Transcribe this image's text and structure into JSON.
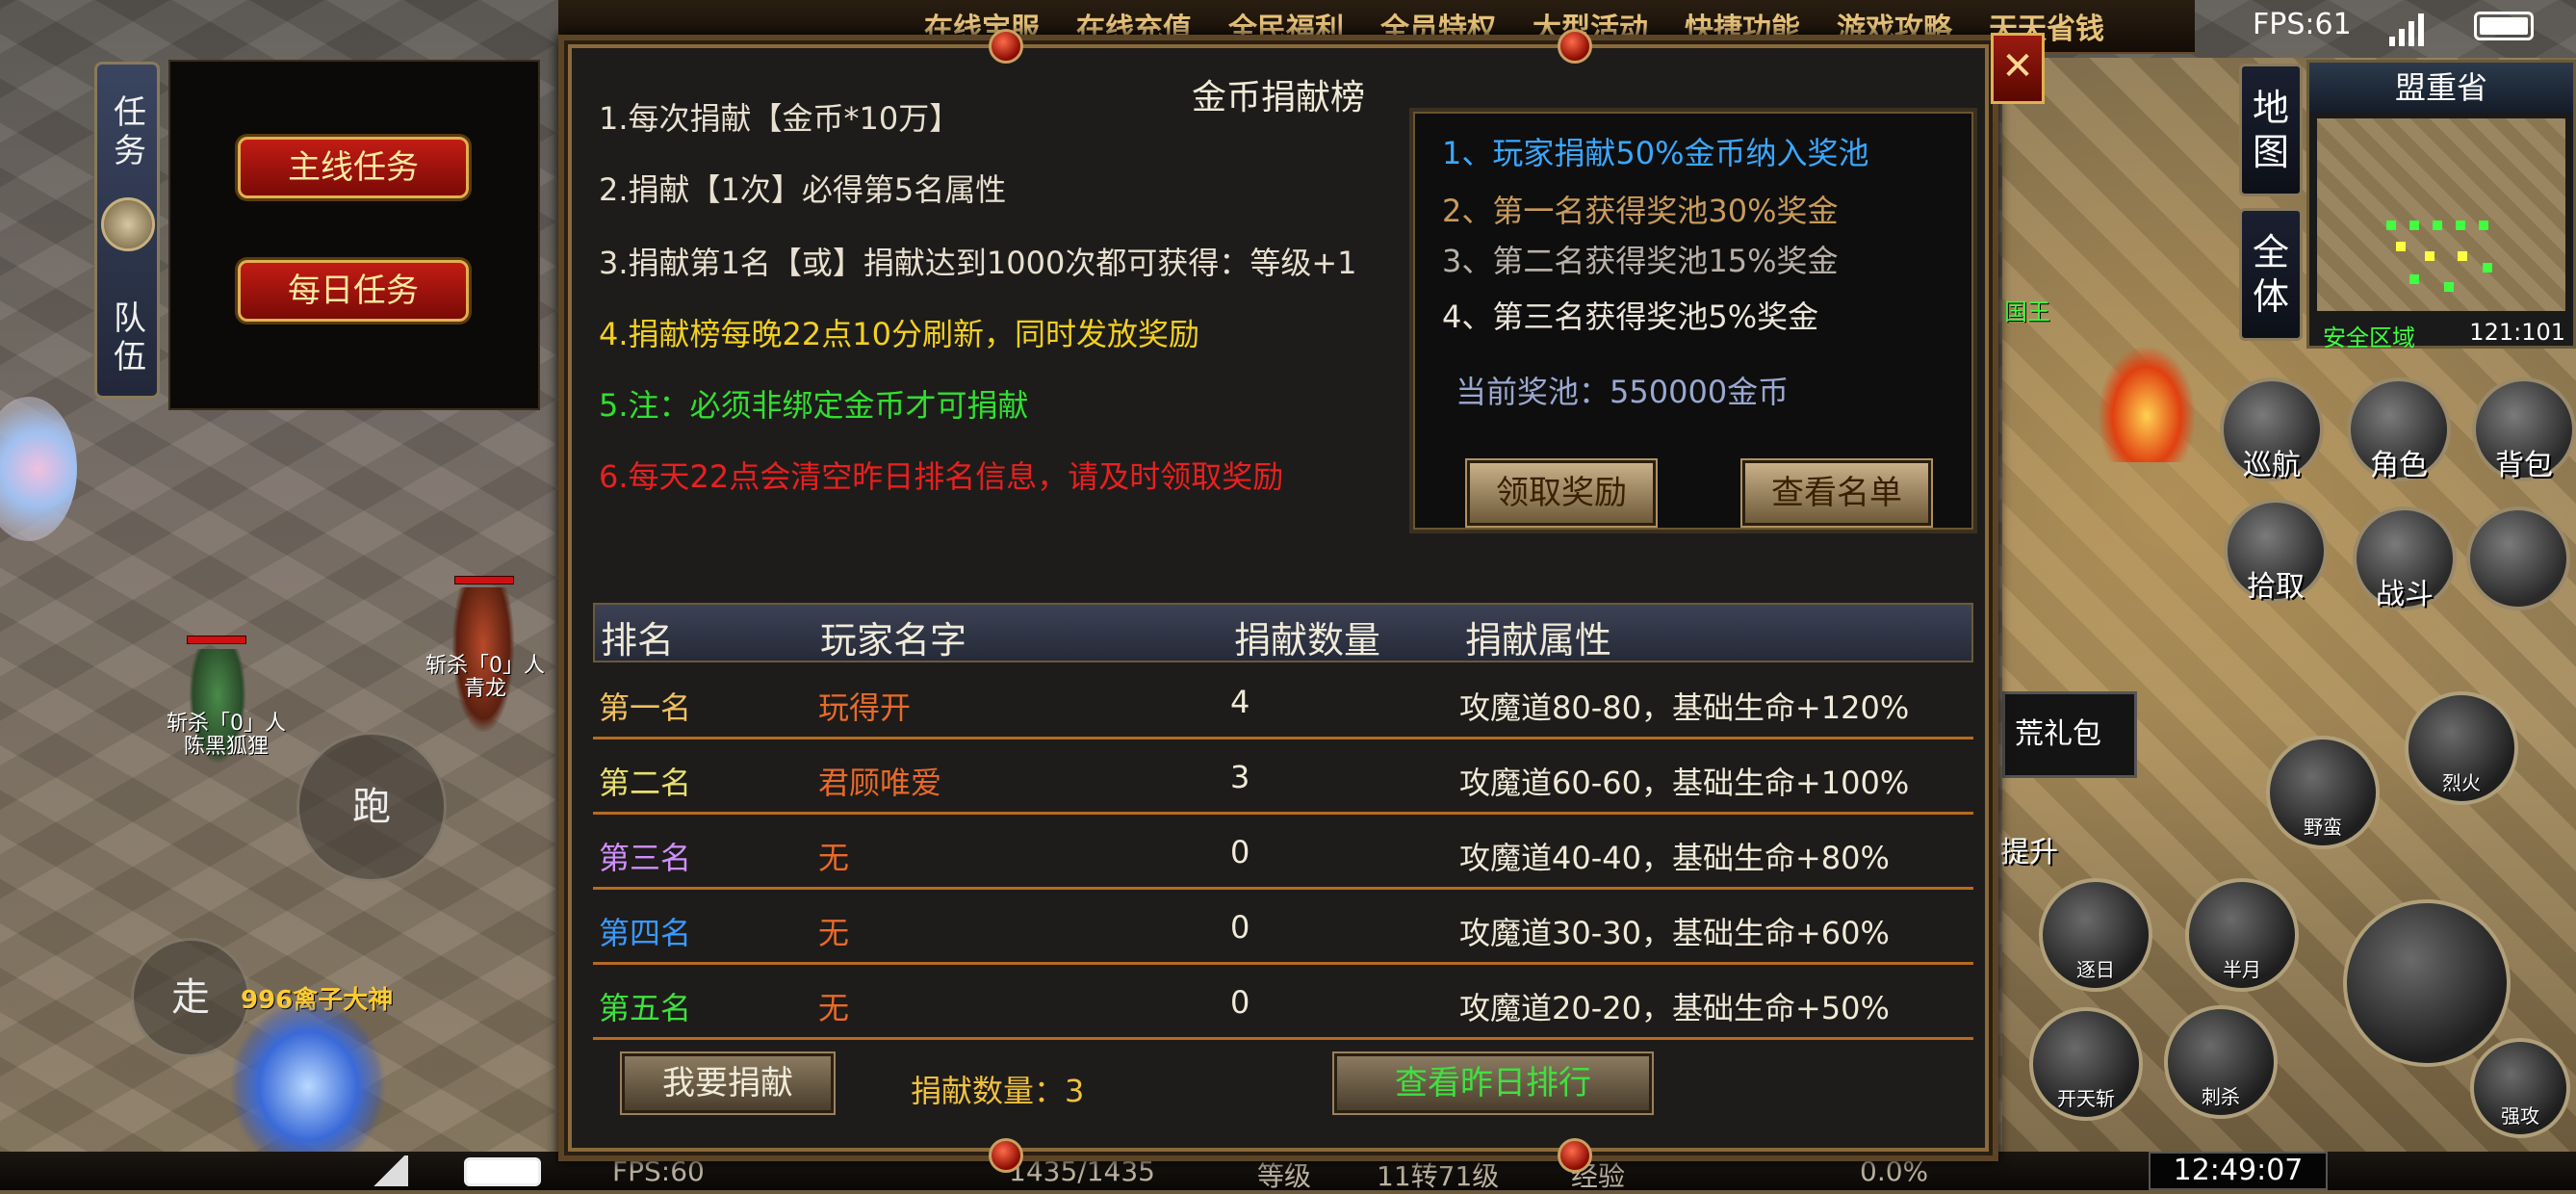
{
  "top_menu": [
    "在线宝服",
    "在线充值",
    "全民福利",
    "全员特权",
    "大型活动",
    "快捷功能",
    "游戏攻略",
    "天天省钱"
  ],
  "status": {
    "fps": "FPS:61"
  },
  "left": {
    "side_tabs": {
      "task": "任务",
      "team": "队伍"
    },
    "quest_buttons": {
      "main": "主线任务",
      "daily": "每日任务"
    },
    "characters": [
      {
        "line1": "斩杀「0」人",
        "line2": "陈黑狐狸"
      },
      {
        "line1": "斩杀「0」人",
        "line2": "青龙"
      }
    ],
    "joystick": {
      "run": "跑",
      "walk": "走"
    },
    "hero_name": "996禽子大神"
  },
  "bottom_bar": {
    "fps": "FPS:60",
    "hp": "1435/1435",
    "level_label": "等级",
    "level_value": "11转71级",
    "exp_label": "经验",
    "exp_value": "0.0%",
    "time": "12:49:07"
  },
  "right_hud": {
    "map_tabs": {
      "map": "地图",
      "all": "全体"
    },
    "minimap": {
      "title": "盟重省",
      "safe_zone": "安全区域",
      "coords": "121:101"
    },
    "partial_labels": {
      "king": "国王",
      "gift": "荒礼包",
      "upgrade": "提升"
    },
    "buttons": {
      "patrol": "巡航",
      "character": "角色",
      "bag": "背包",
      "pickup": "拾取",
      "battle": "战斗"
    },
    "skills": {
      "fire": "烈火",
      "brute": "野蛮",
      "chase": "逐日",
      "half_moon": "半月",
      "open_sky": "开天斩",
      "stab": "刺杀",
      "strong": "强攻"
    }
  },
  "dialog": {
    "title": "金币捐献榜",
    "close": "✕",
    "rules": [
      {
        "text": "1.每次捐献【金币*10万】",
        "color": "#e8e0d0"
      },
      {
        "text": "2.捐献【1次】必得第5名属性",
        "color": "#e8e0d0"
      },
      {
        "text": "3.捐献第1名【或】捐献达到1000次都可获得：等级+1",
        "color": "#e8e0d0"
      },
      {
        "text": "4.捐献榜每晚22点10分刷新，同时发放奖励",
        "color": "#f2d020"
      },
      {
        "text": "5.注：必须非绑定金币才可捐献",
        "color": "#30e030"
      },
      {
        "text": "6.每天22点会清空昨日排名信息，请及时领取奖励",
        "color": "#e82020"
      }
    ],
    "prize_pool": {
      "lines": [
        {
          "text": "1、玩家捐献50%金币纳入奖池",
          "color": "#3aa8ff"
        },
        {
          "text": "2、第一名获得奖池30%奖金",
          "color": "#c89a5a"
        },
        {
          "text": "3、第二名获得奖池15%奖金",
          "color": "#b8b0a8"
        },
        {
          "text": "4、第三名获得奖池5%奖金",
          "color": "#ece6da"
        }
      ],
      "current_label": "当前奖池：",
      "current_value": "550000金币",
      "claim_button": "领取奖励",
      "list_button": "查看名单"
    },
    "table": {
      "headers": [
        "排名",
        "玩家名字",
        "捐献数量",
        "捐献属性"
      ],
      "rows": [
        {
          "rank": "第一名",
          "rank_color": "#f0c060",
          "name": "玩得开",
          "count": "4",
          "attr": "攻魔道80-80，基础生命+120%"
        },
        {
          "rank": "第二名",
          "rank_color": "#e8e070",
          "name": "君顾唯爱",
          "count": "3",
          "attr": "攻魔道60-60，基础生命+100%"
        },
        {
          "rank": "第三名",
          "rank_color": "#d090ff",
          "name": "无",
          "count": "0",
          "attr": "攻魔道40-40，基础生命+80%"
        },
        {
          "rank": "第四名",
          "rank_color": "#3a9aff",
          "name": "无",
          "count": "0",
          "attr": "攻魔道30-30，基础生命+60%"
        },
        {
          "rank": "第五名",
          "rank_color": "#40e040",
          "name": "无",
          "count": "0",
          "attr": "攻魔道20-20，基础生命+50%"
        }
      ]
    },
    "donate_button": "我要捐献",
    "donate_count_label": "捐献数量：3",
    "yesterday_button": "查看昨日排行"
  }
}
